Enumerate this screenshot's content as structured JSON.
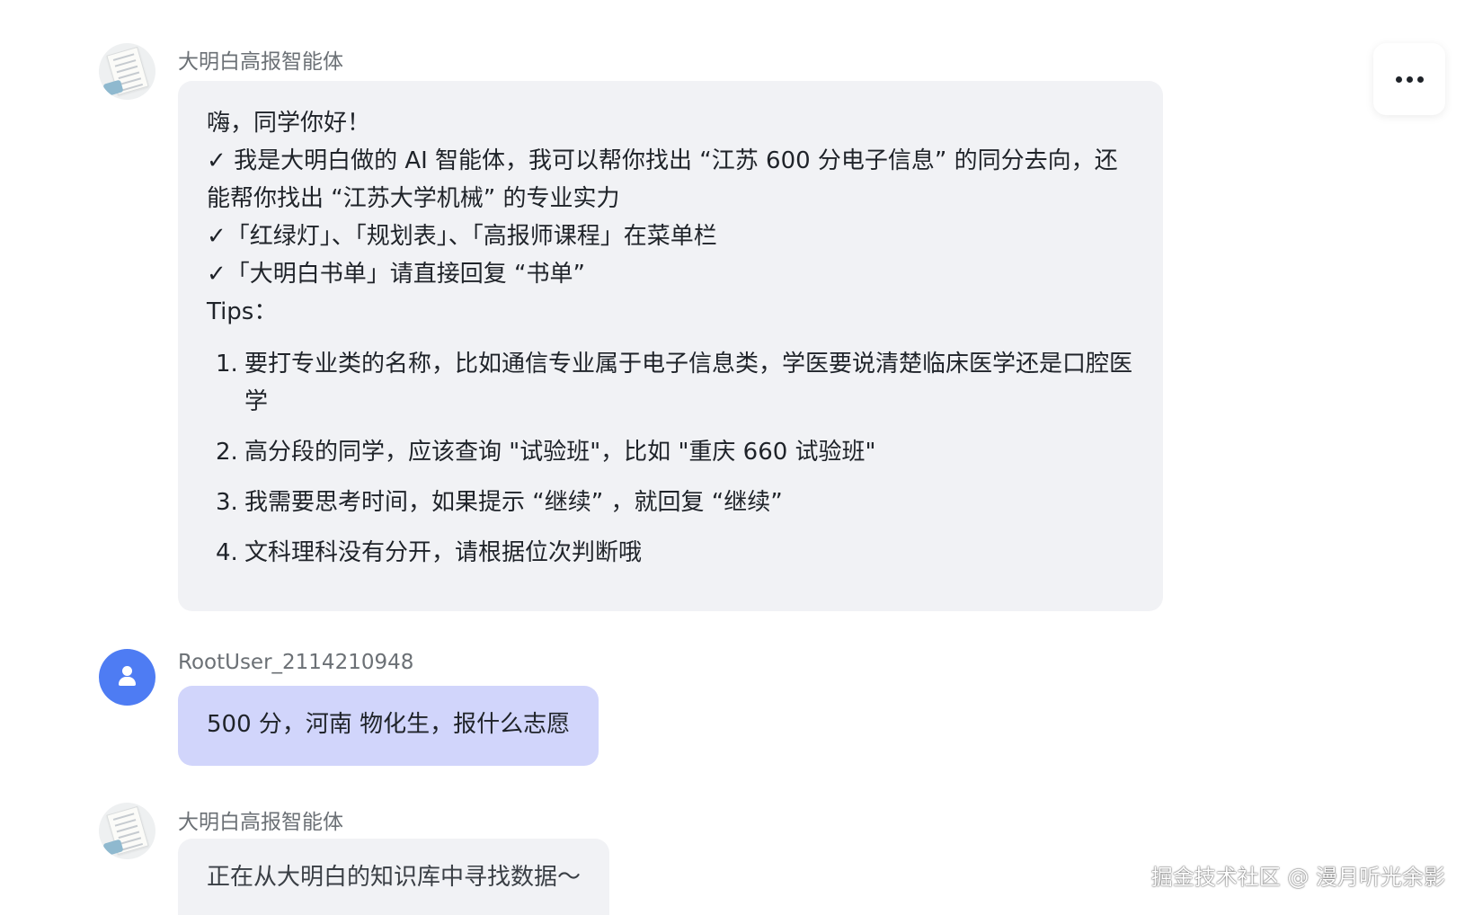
{
  "messages": [
    {
      "sender": "大明白高报智能体",
      "intro": {
        "greeting": "嗨，同学你好！",
        "check_mark": "✓",
        "feature_1": "我是大明白做的 AI 智能体，我可以帮你找出 “江苏 600 分电子信息” 的同分去向，还能帮你找出 “江苏大学机械” 的专业实力",
        "feature_2": "「红绿灯」、「规划表」、「高报师课程」在菜单栏",
        "feature_3": "「大明白书单」请直接回复 “书单”",
        "tips_label": "Tips："
      },
      "tips": [
        {
          "num": "1.",
          "text": "要打专业类的名称，比如通信专业属于电子信息类，学医要说清楚临床医学还是口腔医学"
        },
        {
          "num": "2.",
          "text": "高分段的同学，应该查询 \"试验班\"，比如 \"重庆 660 试验班\""
        },
        {
          "num": "3.",
          "text": "我需要思考时间，如果提示 “继续” ，就回复 “继续”"
        },
        {
          "num": "4.",
          "text": "文科理科没有分开，请根据位次判断哦"
        }
      ]
    },
    {
      "sender": "RootUser_2114210948",
      "text": "500 分，河南 物化生，报什么志愿"
    },
    {
      "sender": "大明白高报智能体",
      "text": "正在从大明白的知识库中寻找数据～"
    }
  ],
  "more_menu_icon": "more-horizontal-icon",
  "watermark": "掘金技术社区 @ 漫月听光余影",
  "colors": {
    "bot_bubble": "#f1f2f5",
    "user_bubble": "#d1d5fb",
    "user_avatar": "#4e7cf3"
  }
}
